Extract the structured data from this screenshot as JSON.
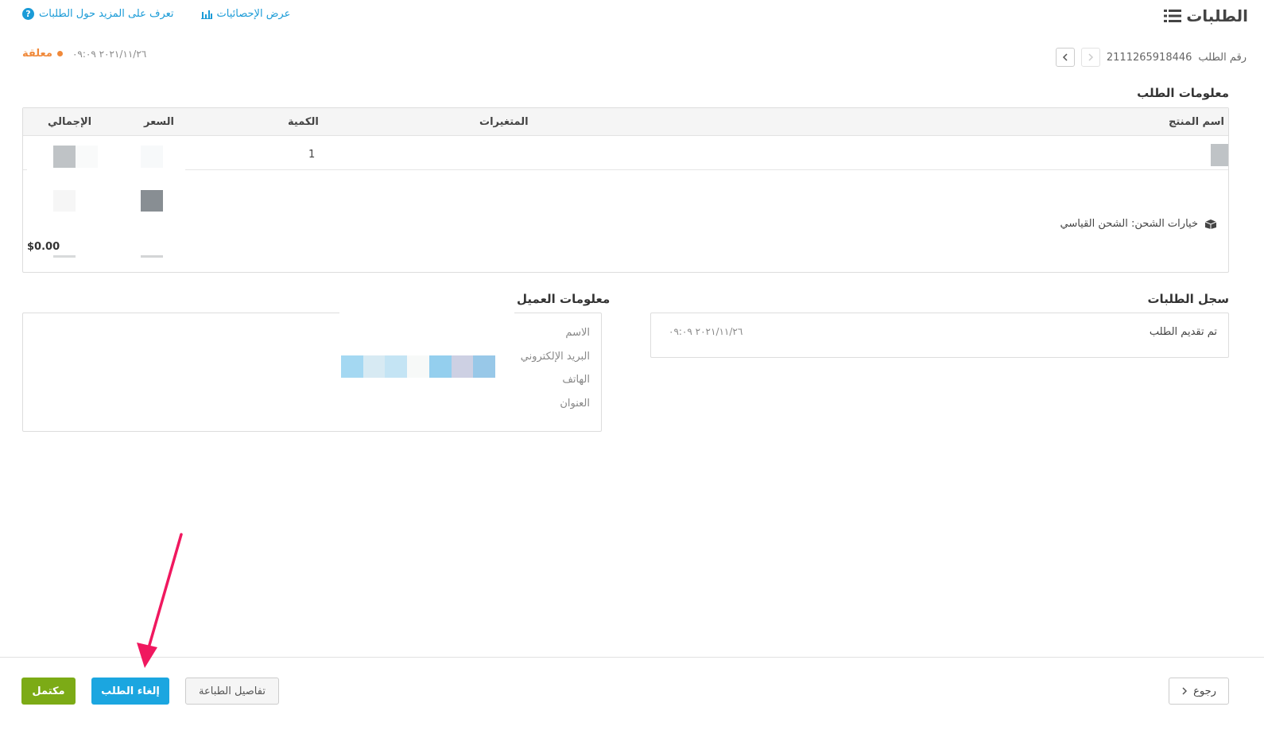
{
  "header": {
    "title": "الطلبات",
    "stats_link": "عرض الإحصائيات",
    "learn_link": "تعرف على المزيد حول الطلبات"
  },
  "order": {
    "number_label": "رقم الطلب",
    "number": "2111265918446",
    "status": "معلقة",
    "date": "٢٠٢١/١١/٢٦ ٠٩:٠٩"
  },
  "order_info": {
    "title": "معلومات الطلب",
    "columns": {
      "product": "اسم المنتج",
      "variants": "المتغيرات",
      "quantity": "الكمية",
      "price": "السعر",
      "total": "الإجمالي"
    },
    "rows": [
      {
        "quantity": "1"
      }
    ],
    "shipping_text": "خيارات الشحن: الشحن القياسي",
    "total_value": "$0.00"
  },
  "history": {
    "title": "سجل الطلبات",
    "entries": [
      {
        "text": "تم تقديم الطلب",
        "date": "٢٠٢١/١١/٢٦ ٠٩:٠٩"
      }
    ]
  },
  "customer": {
    "title": "معلومات العميل",
    "labels": {
      "name": "الاسم",
      "email": "البريد الإلكتروني",
      "phone": "الهاتف",
      "address": "العنوان"
    }
  },
  "footer": {
    "back": "رجوع",
    "print": "تفاصيل الطباعة",
    "cancel": "إلغاء الطلب",
    "complete": "مكتمل"
  },
  "colors": {
    "accent": "#1a9bd7",
    "status_pending": "#f0893a",
    "complete_button": "#7cab16",
    "cancel_button": "#1ba6e0",
    "annotation_arrow": "#f0185f"
  }
}
